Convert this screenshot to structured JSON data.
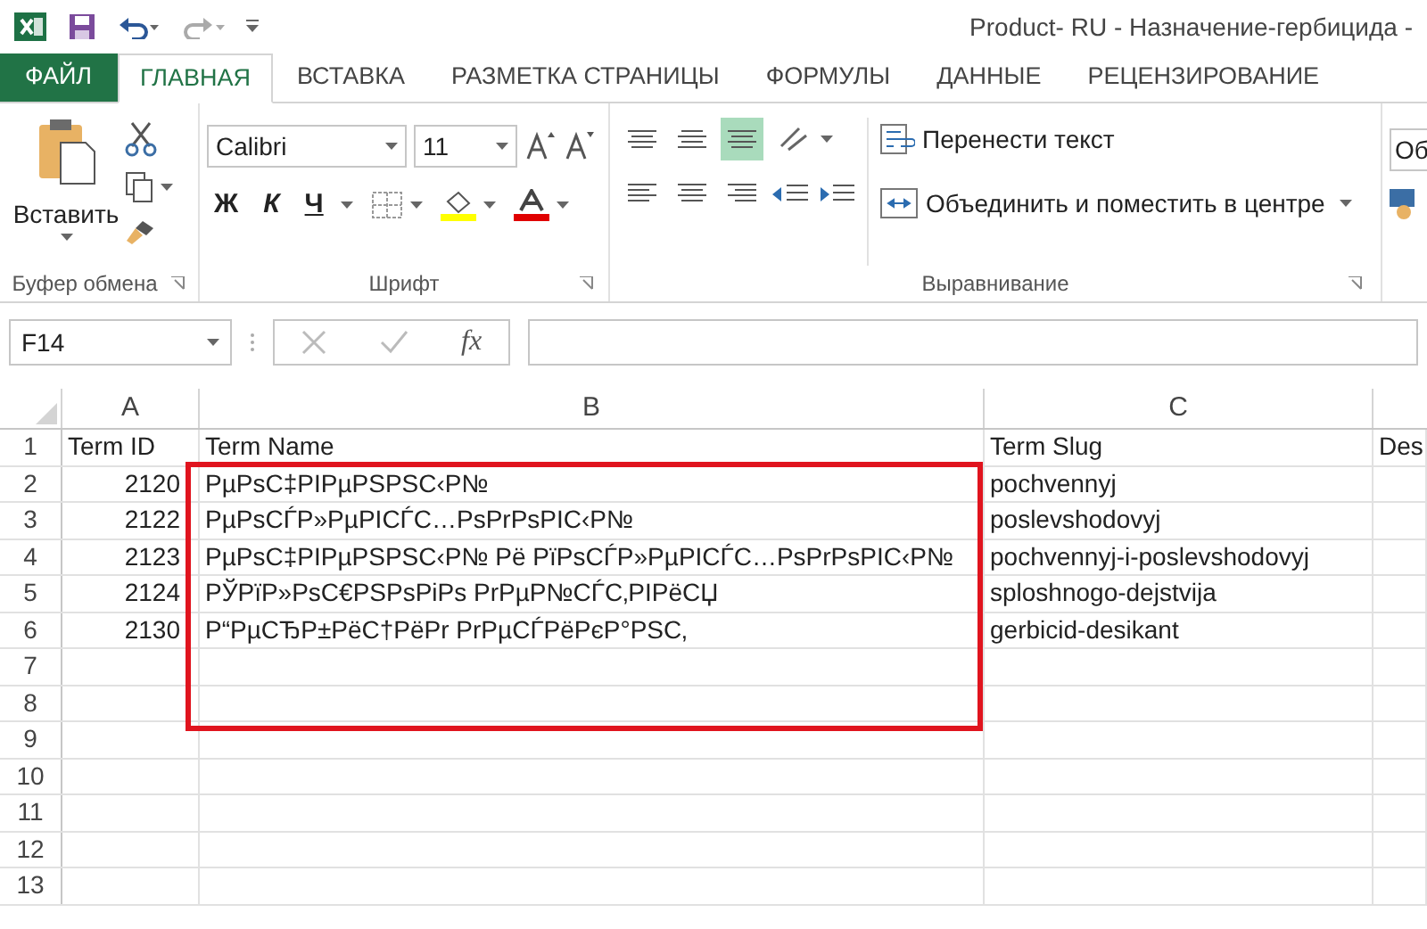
{
  "window": {
    "title": "Product- RU - Назначение-гербицида -"
  },
  "ribbon_tabs": [
    {
      "label": "ФАЙЛ",
      "kind": "file"
    },
    {
      "label": "ГЛАВНАЯ",
      "kind": "tab",
      "selected": true
    },
    {
      "label": "ВСТАВКА",
      "kind": "tab",
      "selected": false
    },
    {
      "label": "РАЗМЕТКА СТРАНИЦЫ",
      "kind": "tab",
      "selected": false
    },
    {
      "label": "ФОРМУЛЫ",
      "kind": "tab",
      "selected": false
    },
    {
      "label": "ДАННЫЕ",
      "kind": "tab",
      "selected": false
    },
    {
      "label": "РЕЦЕНЗИРОВАНИЕ",
      "kind": "tab",
      "selected": false
    }
  ],
  "clipboard": {
    "paste": "Вставить",
    "group_label": "Буфер обмена"
  },
  "font": {
    "font_name": "Calibri",
    "font_size": "11",
    "bold": "Ж",
    "italic": "К",
    "underline": "Ч",
    "group_label": "Шрифт"
  },
  "alignment": {
    "top_buttons": [
      {
        "selected": false
      },
      {
        "selected": false
      },
      {
        "selected": true
      }
    ],
    "wrap_text": "Перенести текст",
    "merge_center": "Объединить и поместить в центре",
    "group_label": "Выравнивание"
  },
  "number": {
    "format_field": "Об"
  },
  "formula_bar": {
    "name_box": "F14",
    "fx": "fx"
  },
  "sheet": {
    "columns": [
      "A",
      "B",
      "C"
    ],
    "rows": [
      {
        "number": "1",
        "cells": [
          "Term ID",
          "Term Name",
          "Term Slug",
          "Des"
        ]
      },
      {
        "number": "2",
        "cells": [
          "2120",
          "PµPsC‡PIPµPSPSC‹P№",
          "pochvennyj"
        ]
      },
      {
        "number": "3",
        "cells": [
          "2122",
          "PµPsCЃP»PµPICЃC…PsPrPsPIC‹P№",
          "poslevshodovyj"
        ]
      },
      {
        "number": "4",
        "cells": [
          "2123",
          "PµPsC‡PIPµPSPSC‹P№ Pё PïPsCЃP»PµPICЃC…PsPrPsPIC‹P№",
          "pochvennyj-i-poslevshodovyj"
        ]
      },
      {
        "number": "5",
        "cells": [
          "2124",
          "PЎPïP»PsC€PSPsPiPs PrPµP№CЃC‚PIPёCЏ",
          "sploshnogo-dejstvija"
        ]
      },
      {
        "number": "6",
        "cells": [
          "2130",
          "P“PµCЂP±PёC†PёPr PrPµCЃPёPєP°PSC‚",
          "gerbicid-desikant"
        ]
      },
      {
        "number": "7"
      },
      {
        "number": "8"
      },
      {
        "number": "9"
      },
      {
        "number": "10"
      },
      {
        "number": "11"
      },
      {
        "number": "12"
      },
      {
        "number": "13"
      }
    ]
  }
}
